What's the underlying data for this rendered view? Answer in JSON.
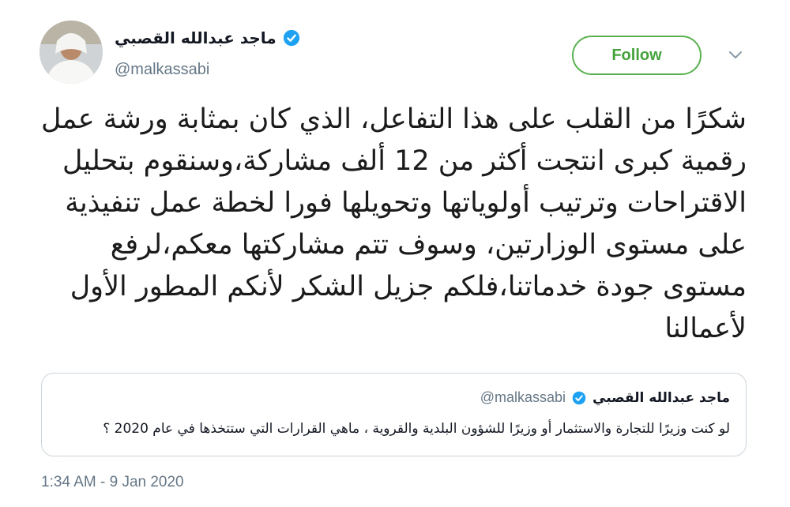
{
  "author": {
    "name": "ماجد عبدالله القصبي",
    "handle": "@malkassabi",
    "verified": true
  },
  "follow_button": {
    "label": "Follow"
  },
  "tweet": {
    "lines": [
      "شكرًا من القلب على هذا التفاعل، الذي كان بمثابة ورشة عمل",
      "رقمية كبرى انتجت أكثر من 12 ألف مشاركة،وسنقوم بتحليل",
      "الاقتراحات وترتيب أولوياتها وتحويلها فورا لخطة عمل تنفيذية",
      "على مستوى الوزارتين، وسوف تتم مشاركتها معكم،لرفع",
      "مستوى جودة خدماتنا،فلكم جزيل الشكر لأنكم المطور الأول",
      "لأعمالنا"
    ]
  },
  "quoted_tweet": {
    "name": "ماجد عبدالله القصبي",
    "handle": "@malkassabi",
    "text": "لو كنت وزيرًا للتجارة والاستثمار أو وزيرًا للشؤون البلدية والقروية ، ماهي القرارات التي ستتخذها في عام 2020 ؟"
  },
  "timestamp": "1:34 AM - 9 Jan 2020",
  "colors": {
    "verified_blue": "#1da1f2",
    "follow_green": "#45a33c",
    "secondary_text": "#657786"
  },
  "icons": {
    "verified": "verified-badge-icon",
    "menu": "chevron-down-icon"
  }
}
